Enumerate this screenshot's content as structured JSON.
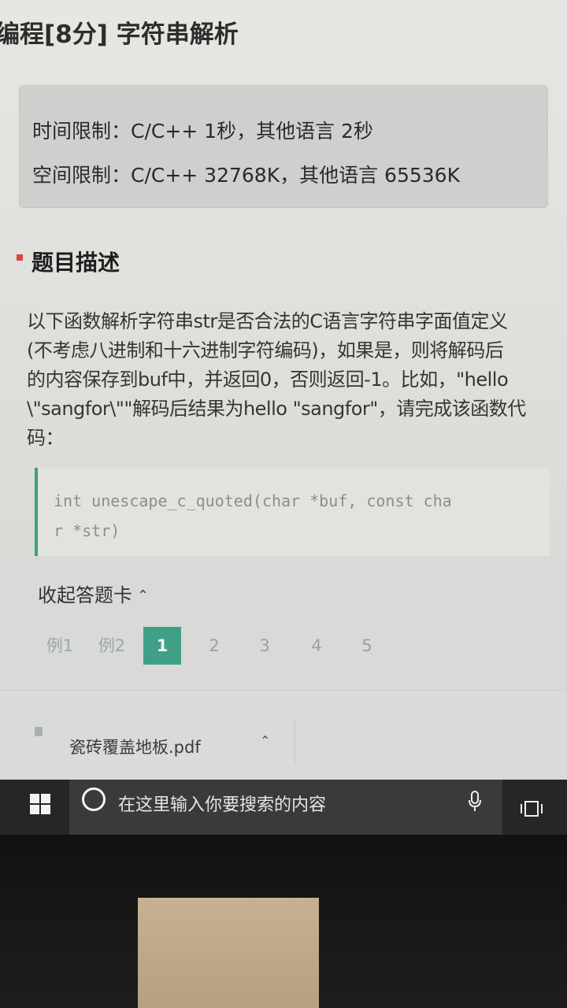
{
  "page": {
    "title": "编程[8分] 字符串解析"
  },
  "limits": {
    "time": "时间限制：C/C++ 1秒，其他语言 2秒",
    "space": "空间限制：C/C++ 32768K，其他语言 65536K"
  },
  "section": {
    "title": "题目描述"
  },
  "description": {
    "lines": [
      "以下函数解析字符串str是否合法的C语言字符串字面值定义",
      "(不考虑八进制和十六进制字符编码)，如果是，则将解码后",
      "的内容保存到buf中，并返回0，否则返回-1。比如，\"hello",
      "\\\"sangfor\\\"\"解码后结果为hello \"sangfor\"，请完成该函数代",
      "码："
    ]
  },
  "code": {
    "lines": [
      "int unescape_c_quoted(char *buf, const cha",
      "r *str)"
    ]
  },
  "answer_card": {
    "toggle_label": "收起答题卡",
    "toggle_icon": "chevron-up-icon",
    "items": [
      "例1",
      "例2",
      "1",
      "2",
      "3",
      "4",
      "5"
    ],
    "active_index": 2
  },
  "colors": {
    "accent": "#3f9f87",
    "section_marker": "#d9453b",
    "code_border": "#3ca17f"
  },
  "download_bar": {
    "file_name": "瓷砖覆盖地板.pdf",
    "icon": "file-icon",
    "chevron": "chevron-up-icon"
  },
  "taskbar": {
    "search_placeholder": "在这里输入你要搜索的内容",
    "icons": [
      "windows-start-icon",
      "cortana-icon",
      "microphone-icon",
      "task-view-icon"
    ]
  }
}
